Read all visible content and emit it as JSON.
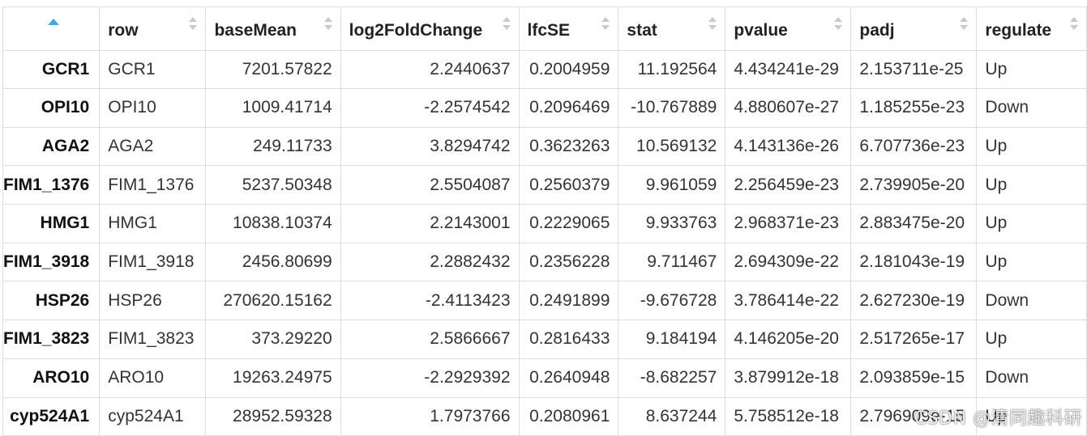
{
  "table": {
    "columns": [
      "",
      "row",
      "baseMean",
      "log2FoldChange",
      "lfcSE",
      "stat",
      "pvalue",
      "padj",
      "regulate"
    ],
    "rows": [
      {
        "rowname": "GCR1",
        "row": "GCR1",
        "baseMean": "7201.57822",
        "log2FoldChange": "2.2440637",
        "lfcSE": "0.2004959",
        "stat": "11.192564",
        "pvalue": "4.434241e-29",
        "padj": "2.153711e-25",
        "regulate": "Up"
      },
      {
        "rowname": "OPI10",
        "row": "OPI10",
        "baseMean": "1009.41714",
        "log2FoldChange": "-2.2574542",
        "lfcSE": "0.2096469",
        "stat": "-10.767889",
        "pvalue": "4.880607e-27",
        "padj": "1.185255e-23",
        "regulate": "Down"
      },
      {
        "rowname": "AGA2",
        "row": "AGA2",
        "baseMean": "249.11733",
        "log2FoldChange": "3.8294742",
        "lfcSE": "0.3623263",
        "stat": "10.569132",
        "pvalue": "4.143136e-26",
        "padj": "6.707736e-23",
        "regulate": "Up"
      },
      {
        "rowname": "FIM1_1376",
        "row": "FIM1_1376",
        "baseMean": "5237.50348",
        "log2FoldChange": "2.5504087",
        "lfcSE": "0.2560379",
        "stat": "9.961059",
        "pvalue": "2.256459e-23",
        "padj": "2.739905e-20",
        "regulate": "Up"
      },
      {
        "rowname": "HMG1",
        "row": "HMG1",
        "baseMean": "10838.10374",
        "log2FoldChange": "2.2143001",
        "lfcSE": "0.2229065",
        "stat": "9.933763",
        "pvalue": "2.968371e-23",
        "padj": "2.883475e-20",
        "regulate": "Up"
      },
      {
        "rowname": "FIM1_3918",
        "row": "FIM1_3918",
        "baseMean": "2456.80699",
        "log2FoldChange": "2.2882432",
        "lfcSE": "0.2356228",
        "stat": "9.711467",
        "pvalue": "2.694309e-22",
        "padj": "2.181043e-19",
        "regulate": "Up"
      },
      {
        "rowname": "HSP26",
        "row": "HSP26",
        "baseMean": "270620.15162",
        "log2FoldChange": "-2.4113423",
        "lfcSE": "0.2491899",
        "stat": "-9.676728",
        "pvalue": "3.786414e-22",
        "padj": "2.627230e-19",
        "regulate": "Down"
      },
      {
        "rowname": "FIM1_3823",
        "row": "FIM1_3823",
        "baseMean": "373.29220",
        "log2FoldChange": "2.5866667",
        "lfcSE": "0.2816433",
        "stat": "9.184194",
        "pvalue": "4.146205e-20",
        "padj": "2.517265e-17",
        "regulate": "Up"
      },
      {
        "rowname": "ARO10",
        "row": "ARO10",
        "baseMean": "19263.24975",
        "log2FoldChange": "-2.2929392",
        "lfcSE": "0.2640948",
        "stat": "-8.682257",
        "pvalue": "3.879912e-18",
        "padj": "2.093859e-15",
        "regulate": "Down"
      },
      {
        "rowname": "cyp524A1",
        "row": "cyp524A1",
        "baseMean": "28952.59328",
        "log2FoldChange": "1.7973766",
        "lfcSE": "0.2080961",
        "stat": "8.637244",
        "pvalue": "5.758512e-18",
        "padj": "2.796909e-15",
        "regulate": "Up"
      }
    ]
  },
  "watermark": "CSDN @清同趣科研",
  "colors": {
    "sort_active": "#4aa3df",
    "sort_inactive": "#c9c9c9",
    "grid": "#dddddd"
  },
  "icons": {
    "sort_active": "sort-ascending-icon",
    "sort_both": "sort-both-icon"
  }
}
